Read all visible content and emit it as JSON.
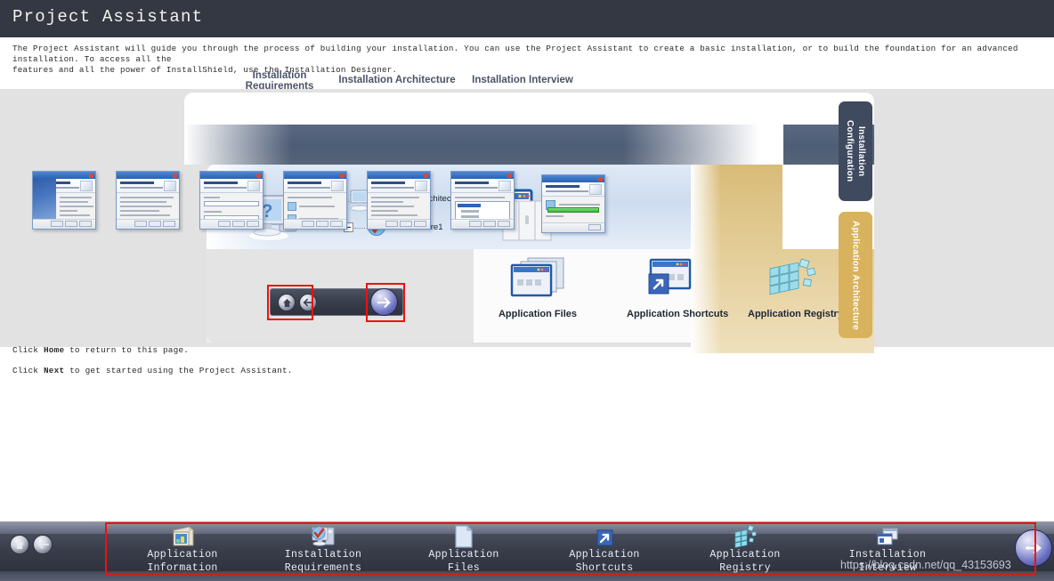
{
  "window": {
    "title": "Project Assistant"
  },
  "intro": {
    "line1": "The Project Assistant will guide you through the process of building your installation. You can use the Project Assistant to create a basic installation, or to build the foundation for an advanced installation. To access all the",
    "line2": "features and all the power of InstallShield, use the Installation Designer."
  },
  "diagram": {
    "headings": {
      "requirements": "Installation\nRequirements",
      "architecture": "Installation Architecture",
      "interview": "Installation Interview"
    },
    "side_tabs": {
      "configuration": "Installation Configuration",
      "app_architecture": "Application Architecture"
    },
    "tree": {
      "root_label": "Installation Architecture",
      "child_label": "NewFeature1"
    },
    "features": [
      {
        "label": "Application Files",
        "icon": "application-files-icon"
      },
      {
        "label": "Application Shortcuts",
        "icon": "application-shortcuts-icon"
      },
      {
        "label": "Application Registry",
        "icon": "application-registry-icon"
      }
    ],
    "mini_nav": {
      "home": "home-icon",
      "back": "back-arrow-icon",
      "next": "next-arrow-icon"
    },
    "requirements_icon": "computer-question-icon",
    "interview_icon": "dialog-windows-icon"
  },
  "helper": {
    "line1_pre": "Click ",
    "line1_bold": "Home",
    "line1_post": " to return to this page.",
    "line2_pre": "Click ",
    "line2_bold": "Next",
    "line2_post": " to get started using the Project Assistant."
  },
  "toolbar": {
    "home_icon": "home-icon",
    "back_icon": "back-arrow-icon",
    "next_icon": "next-arrow-icon",
    "items": [
      {
        "line1": "Application",
        "line2": "Information",
        "icon": "application-information-icon"
      },
      {
        "line1": "Installation",
        "line2": "Requirements",
        "icon": "installation-requirements-icon"
      },
      {
        "line1": "Application",
        "line2": "Files",
        "icon": "application-files-icon"
      },
      {
        "line1": "Application",
        "line2": "Shortcuts",
        "icon": "application-shortcuts-icon"
      },
      {
        "line1": "Application",
        "line2": "Registry",
        "icon": "application-registry-icon"
      },
      {
        "line1": "Installation",
        "line2": "Interview",
        "icon": "installation-interview-icon"
      }
    ]
  },
  "watermark": {
    "text": "https://blog.csdn.net/qq_43153693"
  },
  "colors": {
    "titlebar": "#343842",
    "stage_bg": "#e2e2e2",
    "tab_configuration": "#3f4a5e",
    "tab_app_architecture": "#d9b25e",
    "annotation_red": "#ee1111",
    "toolbar_dark": "#333742"
  }
}
